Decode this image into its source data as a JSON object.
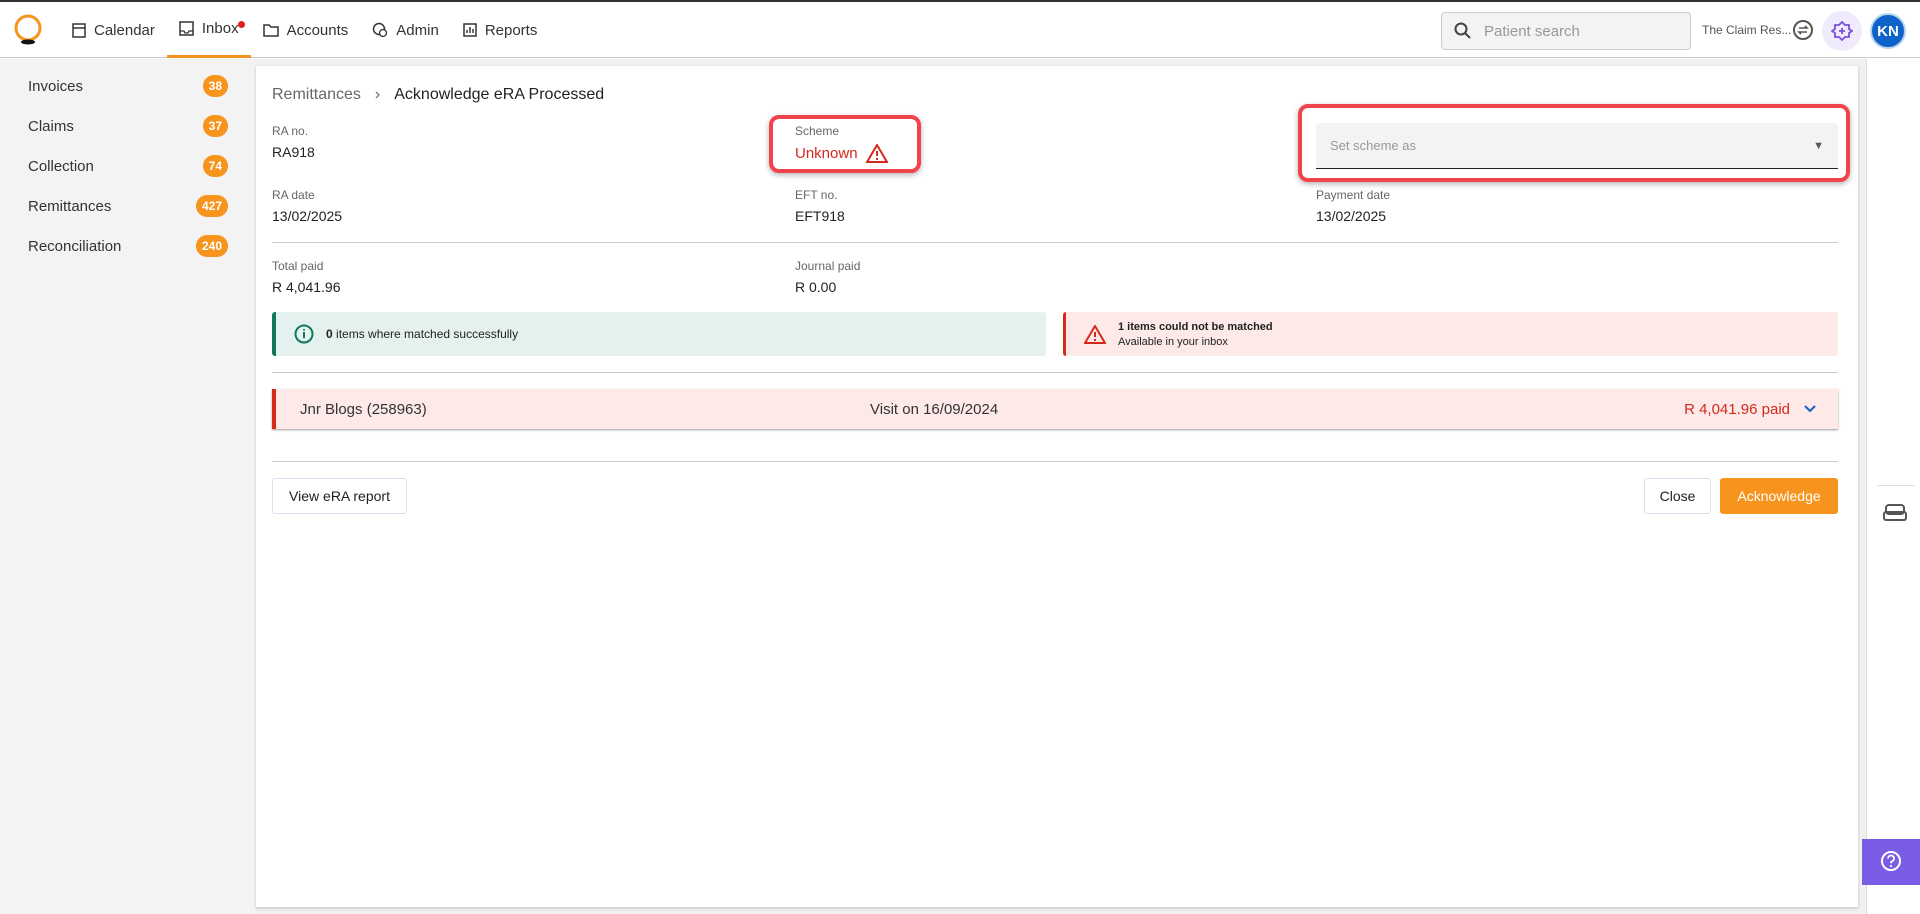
{
  "nav": {
    "items": [
      {
        "label": "Calendar",
        "icon": "calendar-icon"
      },
      {
        "label": "Inbox",
        "icon": "inbox-icon",
        "active": true,
        "dot": true
      },
      {
        "label": "Accounts",
        "icon": "folder-icon"
      },
      {
        "label": "Admin",
        "icon": "admin-icon"
      },
      {
        "label": "Reports",
        "icon": "reports-icon"
      }
    ],
    "search_placeholder": "Patient search",
    "practice": "The Claim Res...",
    "avatar": "KN"
  },
  "sidebar": {
    "items": [
      {
        "label": "Invoices",
        "count": "38"
      },
      {
        "label": "Claims",
        "count": "37"
      },
      {
        "label": "Collection",
        "count": "74"
      },
      {
        "label": "Remittances",
        "count": "427"
      },
      {
        "label": "Reconciliation",
        "count": "240"
      }
    ]
  },
  "breadcrumb": {
    "parent": "Remittances",
    "current": "Acknowledge eRA Processed"
  },
  "fields": {
    "ra_no_label": "RA no.",
    "ra_no": "RA918",
    "scheme_label": "Scheme",
    "scheme": "Unknown",
    "select_placeholder": "Set scheme as",
    "ra_date_label": "RA date",
    "ra_date": "13/02/2025",
    "eft_label": "EFT no.",
    "eft": "EFT918",
    "payment_date_label": "Payment date",
    "payment_date": "13/02/2025",
    "total_paid_label": "Total paid",
    "total_paid": "R 4,041.96",
    "journal_paid_label": "Journal paid",
    "journal_paid": "R 0.00"
  },
  "alerts": {
    "matched_count": "0",
    "matched_text": " items where matched successfully",
    "unmatched_title": "1 items could not be matched",
    "unmatched_sub": "Available in your inbox"
  },
  "visit": {
    "patient": "Jnr Blogs (258963)",
    "date": "Visit on 16/09/2024",
    "amount": "R 4,041.96 paid"
  },
  "buttons": {
    "view_report": "View eRA report",
    "close": "Close",
    "acknowledge": "Acknowledge"
  },
  "colors": {
    "accent": "#f7941d",
    "error": "#d42a1c",
    "success": "#0f7a5a",
    "help": "#7b5ce6"
  }
}
